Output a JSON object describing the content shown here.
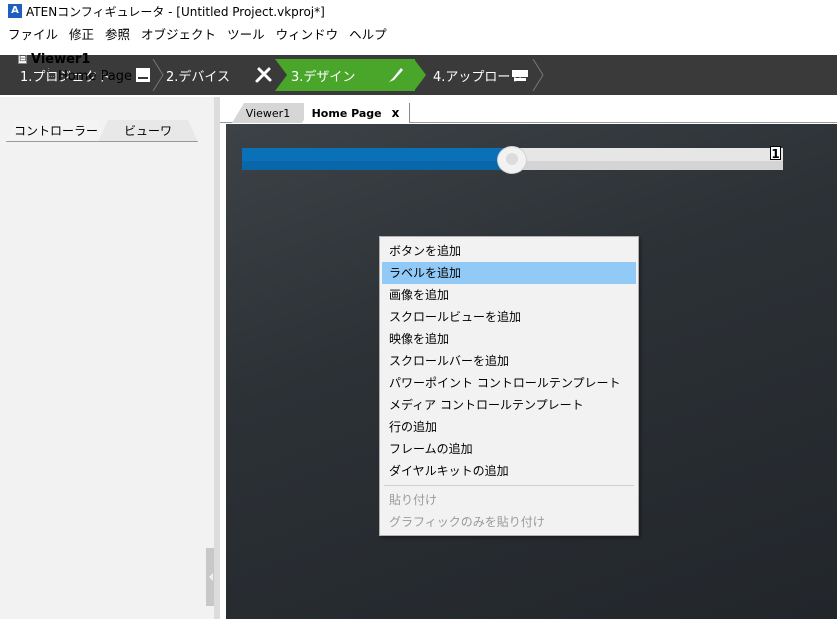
{
  "window": {
    "app_icon": "aten-app-icon",
    "title": "ATENコンフィギュレータ - [Untitled Project.vkproj*]"
  },
  "menubar": [
    "ファイル",
    "修正",
    "参照",
    "オブジェクト",
    "ツール",
    "ウィンドウ",
    "ヘルプ"
  ],
  "steps": [
    {
      "label": "1.プロジェクト",
      "icon": "device-icon"
    },
    {
      "label": "2.デバイス",
      "icon": "tools-icon"
    },
    {
      "label": "3.デザイン",
      "icon": "paintbrush-icon",
      "active": true
    },
    {
      "label": "4.アップロード",
      "icon": "upload-icon"
    }
  ],
  "left_panel": {
    "tabs": [
      "コントローラー",
      "ビューワ"
    ],
    "tree": {
      "root": "Viewer1",
      "expander": "⊟",
      "child": "Home Page"
    }
  },
  "doc_tabs": {
    "viewer1": "Viewer1",
    "homepage": "Home Page",
    "close": "x"
  },
  "canvas": {
    "slider_value_label": "1",
    "slider_fill_fraction": 0.5
  },
  "context_menu": {
    "items": [
      "ボタンを追加",
      "ラベルを追加",
      "画像を追加",
      "スクロールビューを追加",
      "映像を追加",
      "スクロールバーを追加",
      "パワーポイント コントロールテンプレート",
      "メディア コントロールテンプレート",
      "行の追加",
      "フレームの追加",
      "ダイヤルキットの追加"
    ],
    "disabled_items": [
      "貼り付け",
      "グラフィックのみを貼り付け"
    ],
    "highlighted_index": 1
  },
  "colors": {
    "active_step": "#4aa62b",
    "slider_fill": "#0a70b8",
    "menu_highlight": "#91c9f7"
  }
}
